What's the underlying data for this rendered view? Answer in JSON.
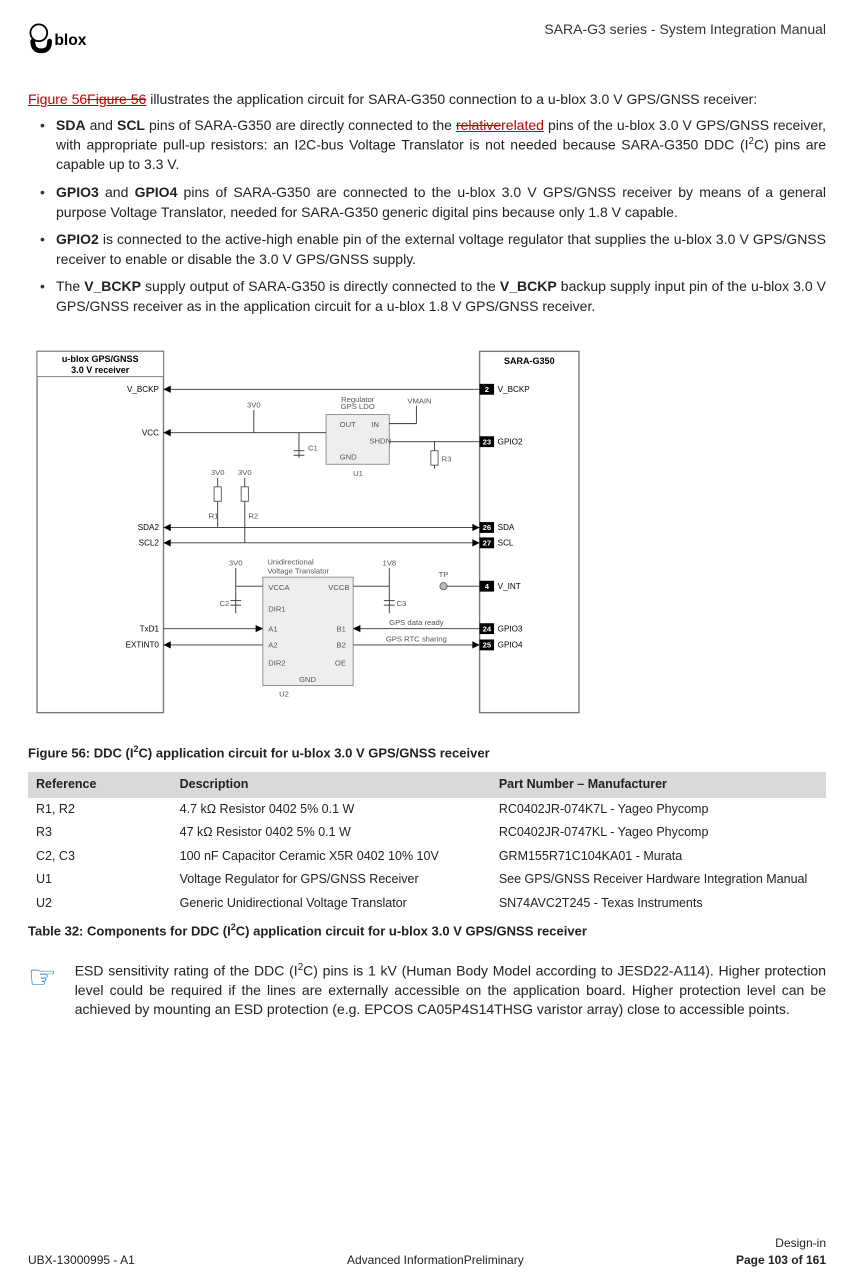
{
  "header": {
    "doc_title": "SARA-G3 series - System Integration Manual"
  },
  "intro": {
    "link_text": "Figure  56",
    "strike_text": "Figure  56",
    "rest": " illustrates the application circuit for SARA-G350 connection to a u-blox 3.0 V GPS/GNSS receiver:"
  },
  "bullets": {
    "b1_a": "SDA",
    "b1_b": "SCL",
    "b1_c": " pins of SARA-G350 are directly connected to the ",
    "b1_rel_strike": "relative",
    "b1_rel": "related",
    "b1_d": " pins of the u-blox 3.0 V GPS/GNSS receiver, with appropriate pull-up resistors: an I2C-bus Voltage Translator is not needed because SARA-G350 DDC (I",
    "b1_sup": "2",
    "b1_e": "C) pins are capable up to 3.3 V.",
    "b2_a": "GPIO3",
    "b2_b": "GPIO4",
    "b2_c": " pins of SARA-G350 are connected to the u-blox 3.0 V GPS/GNSS receiver by means of a general purpose Voltage Translator, needed for SARA-G350 generic digital pins because only 1.8 V capable.",
    "b3_a": "GPIO2",
    "b3_b": " is connected to the active-high enable pin of the external voltage regulator that supplies the u-blox 3.0 V GPS/GNSS receiver to enable or disable the 3.0 V GPS/GNSS supply.",
    "b4_a": "V_BCKP",
    "b4_b": " supply output of SARA-G350 is directly connected to the ",
    "b4_c": "V_BCKP",
    "b4_d": " backup supply input pin of the u-blox 3.0 V GPS/GNSS receiver as in the application circuit for a u-blox 1.8 V GPS/GNSS receiver."
  },
  "figure": {
    "left_box_l1": "u-blox GPS/GNSS",
    "left_box_l2": "3.0 V receiver",
    "right_box": "SARA-G350",
    "ldo_l1": "GPS LDO",
    "ldo_l2": "Regulator",
    "vt_l1": "Unidirectional",
    "vt_l2": "Voltage Translator",
    "pins": {
      "vbckp_l": "V_BCKP",
      "vbckp_r": "V_BCKP",
      "p2": "2",
      "vcc": "VCC",
      "gpio2": "GPIO2",
      "p23": "23",
      "sda2": "SDA2",
      "sda": "SDA",
      "p26": "26",
      "scl2": "SCL2",
      "scl": "SCL",
      "p27": "27",
      "vint": "V_INT",
      "p4": "4",
      "txd1": "TxD1",
      "gpio3": "GPIO3",
      "p24": "24",
      "extint0": "EXTINT0",
      "gpio4": "GPIO4",
      "p25": "25"
    },
    "nets": {
      "3v0": "3V0",
      "1v8": "1V8",
      "vmain": "VMAIN",
      "tp": "TP",
      "gps_ready": "GPS data ready",
      "gps_rtc": "GPS RTC sharing"
    },
    "parts": {
      "c1": "C1",
      "c2": "C2",
      "c3": "C3",
      "r1": "R1",
      "r2": "R2",
      "r3": "R3",
      "u1": "U1",
      "u2": "U2",
      "out": "OUT",
      "in": "IN",
      "shdn": "SHDN",
      "gnd": "GND",
      "vcca": "VCCA",
      "vccb": "VCCB",
      "dir1": "DIR1",
      "dir2": "DIR2",
      "a1": "A1",
      "a2": "A2",
      "b1": "B1",
      "b2": "B2",
      "oe": "OE"
    },
    "caption_a": "Figure 56: DDC (I",
    "caption_sup": "2",
    "caption_b": "C) application circuit for u-blox 3.0 V GPS/GNSS receiver"
  },
  "table": {
    "h1": "Reference",
    "h2": "Description",
    "h3": "Part Number – Manufacturer",
    "rows": [
      {
        "r": "R1, R2",
        "d": "4.7 kΩ Resistor 0402 5% 0.1 W",
        "p": "RC0402JR-074K7L - Yageo Phycomp"
      },
      {
        "r": "R3",
        "d": "47 kΩ Resistor 0402 5% 0.1 W",
        "p": "RC0402JR-0747KL - Yageo Phycomp"
      },
      {
        "r": "C2, C3",
        "d": "100 nF Capacitor Ceramic X5R 0402 10% 10V",
        "p": "GRM155R71C104KA01 - Murata"
      },
      {
        "r": "U1",
        "d": "Voltage Regulator for GPS/GNSS Receiver",
        "p": "See GPS/GNSS Receiver Hardware Integration Manual"
      },
      {
        "r": "U2",
        "d": "Generic Unidirectional Voltage Translator",
        "p": "SN74AVC2T245 - Texas Instruments"
      }
    ],
    "caption_a": "Table 32: Components for DDC (I",
    "caption_sup": "2",
    "caption_b": "C) application circuit for u-blox 3.0 V GPS/GNSS receiver"
  },
  "note": {
    "text_a": "ESD sensitivity rating of the DDC (I",
    "sup": "2",
    "text_b": "C) pins is 1 kV (Human Body Model according to JESD22-A114). Higher protection level could be required if the lines are externally accessible on the application board. Higher protection level can be achieved by mounting an ESD protection (e.g. EPCOS CA05P4S14THSG varistor array) close to accessible points."
  },
  "footer": {
    "left": "UBX-13000995 - A1",
    "center": "Advanced InformationPreliminary",
    "right_top": "Design-in",
    "right_bottom": "Page 103 of 161"
  }
}
